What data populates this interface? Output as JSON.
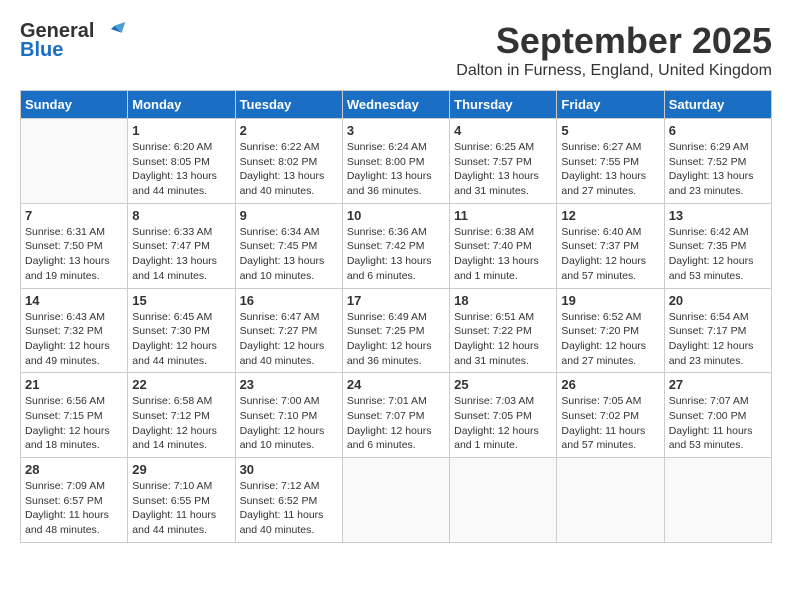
{
  "header": {
    "logo_general": "General",
    "logo_blue": "Blue",
    "month_title": "September 2025",
    "location": "Dalton in Furness, England, United Kingdom"
  },
  "days_of_week": [
    "Sunday",
    "Monday",
    "Tuesday",
    "Wednesday",
    "Thursday",
    "Friday",
    "Saturday"
  ],
  "weeks": [
    [
      {
        "day": "",
        "info": ""
      },
      {
        "day": "1",
        "info": "Sunrise: 6:20 AM\nSunset: 8:05 PM\nDaylight: 13 hours\nand 44 minutes."
      },
      {
        "day": "2",
        "info": "Sunrise: 6:22 AM\nSunset: 8:02 PM\nDaylight: 13 hours\nand 40 minutes."
      },
      {
        "day": "3",
        "info": "Sunrise: 6:24 AM\nSunset: 8:00 PM\nDaylight: 13 hours\nand 36 minutes."
      },
      {
        "day": "4",
        "info": "Sunrise: 6:25 AM\nSunset: 7:57 PM\nDaylight: 13 hours\nand 31 minutes."
      },
      {
        "day": "5",
        "info": "Sunrise: 6:27 AM\nSunset: 7:55 PM\nDaylight: 13 hours\nand 27 minutes."
      },
      {
        "day": "6",
        "info": "Sunrise: 6:29 AM\nSunset: 7:52 PM\nDaylight: 13 hours\nand 23 minutes."
      }
    ],
    [
      {
        "day": "7",
        "info": "Sunrise: 6:31 AM\nSunset: 7:50 PM\nDaylight: 13 hours\nand 19 minutes."
      },
      {
        "day": "8",
        "info": "Sunrise: 6:33 AM\nSunset: 7:47 PM\nDaylight: 13 hours\nand 14 minutes."
      },
      {
        "day": "9",
        "info": "Sunrise: 6:34 AM\nSunset: 7:45 PM\nDaylight: 13 hours\nand 10 minutes."
      },
      {
        "day": "10",
        "info": "Sunrise: 6:36 AM\nSunset: 7:42 PM\nDaylight: 13 hours\nand 6 minutes."
      },
      {
        "day": "11",
        "info": "Sunrise: 6:38 AM\nSunset: 7:40 PM\nDaylight: 13 hours\nand 1 minute."
      },
      {
        "day": "12",
        "info": "Sunrise: 6:40 AM\nSunset: 7:37 PM\nDaylight: 12 hours\nand 57 minutes."
      },
      {
        "day": "13",
        "info": "Sunrise: 6:42 AM\nSunset: 7:35 PM\nDaylight: 12 hours\nand 53 minutes."
      }
    ],
    [
      {
        "day": "14",
        "info": "Sunrise: 6:43 AM\nSunset: 7:32 PM\nDaylight: 12 hours\nand 49 minutes."
      },
      {
        "day": "15",
        "info": "Sunrise: 6:45 AM\nSunset: 7:30 PM\nDaylight: 12 hours\nand 44 minutes."
      },
      {
        "day": "16",
        "info": "Sunrise: 6:47 AM\nSunset: 7:27 PM\nDaylight: 12 hours\nand 40 minutes."
      },
      {
        "day": "17",
        "info": "Sunrise: 6:49 AM\nSunset: 7:25 PM\nDaylight: 12 hours\nand 36 minutes."
      },
      {
        "day": "18",
        "info": "Sunrise: 6:51 AM\nSunset: 7:22 PM\nDaylight: 12 hours\nand 31 minutes."
      },
      {
        "day": "19",
        "info": "Sunrise: 6:52 AM\nSunset: 7:20 PM\nDaylight: 12 hours\nand 27 minutes."
      },
      {
        "day": "20",
        "info": "Sunrise: 6:54 AM\nSunset: 7:17 PM\nDaylight: 12 hours\nand 23 minutes."
      }
    ],
    [
      {
        "day": "21",
        "info": "Sunrise: 6:56 AM\nSunset: 7:15 PM\nDaylight: 12 hours\nand 18 minutes."
      },
      {
        "day": "22",
        "info": "Sunrise: 6:58 AM\nSunset: 7:12 PM\nDaylight: 12 hours\nand 14 minutes."
      },
      {
        "day": "23",
        "info": "Sunrise: 7:00 AM\nSunset: 7:10 PM\nDaylight: 12 hours\nand 10 minutes."
      },
      {
        "day": "24",
        "info": "Sunrise: 7:01 AM\nSunset: 7:07 PM\nDaylight: 12 hours\nand 6 minutes."
      },
      {
        "day": "25",
        "info": "Sunrise: 7:03 AM\nSunset: 7:05 PM\nDaylight: 12 hours\nand 1 minute."
      },
      {
        "day": "26",
        "info": "Sunrise: 7:05 AM\nSunset: 7:02 PM\nDaylight: 11 hours\nand 57 minutes."
      },
      {
        "day": "27",
        "info": "Sunrise: 7:07 AM\nSunset: 7:00 PM\nDaylight: 11 hours\nand 53 minutes."
      }
    ],
    [
      {
        "day": "28",
        "info": "Sunrise: 7:09 AM\nSunset: 6:57 PM\nDaylight: 11 hours\nand 48 minutes."
      },
      {
        "day": "29",
        "info": "Sunrise: 7:10 AM\nSunset: 6:55 PM\nDaylight: 11 hours\nand 44 minutes."
      },
      {
        "day": "30",
        "info": "Sunrise: 7:12 AM\nSunset: 6:52 PM\nDaylight: 11 hours\nand 40 minutes."
      },
      {
        "day": "",
        "info": ""
      },
      {
        "day": "",
        "info": ""
      },
      {
        "day": "",
        "info": ""
      },
      {
        "day": "",
        "info": ""
      }
    ]
  ]
}
